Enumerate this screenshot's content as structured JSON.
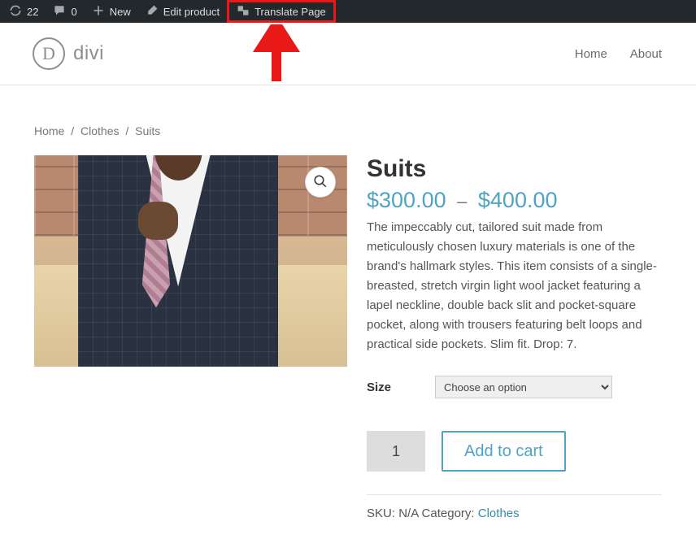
{
  "adminbar": {
    "updates_count": "22",
    "comments_count": "0",
    "new_label": "New",
    "edit_label": "Edit product",
    "translate_label": "Translate Page"
  },
  "header": {
    "logo_letter": "D",
    "logo_word": "divi",
    "nav": {
      "home": "Home",
      "about": "About"
    }
  },
  "breadcrumb": {
    "home": "Home",
    "cat": "Clothes",
    "current": "Suits"
  },
  "product": {
    "title": "Suits",
    "price_low": "$300.00",
    "price_high": "$400.00",
    "description": "The impeccably cut, tailored suit made from meticulously chosen luxury materials is one of the brand's hallmark styles. This item consists of a single-breasted, stretch virgin light wool jacket featuring a lapel neckline, double back slit and pocket-square pocket, along with trousers featuring belt loops and practical side pockets. Slim fit. Drop: 7.",
    "size_label": "Size",
    "size_placeholder": "Choose an option",
    "qty_value": "1",
    "add_label": "Add to cart",
    "sku_label": "SKU:",
    "sku_value": "N/A",
    "category_label": "Category:",
    "category_value": "Clothes"
  }
}
